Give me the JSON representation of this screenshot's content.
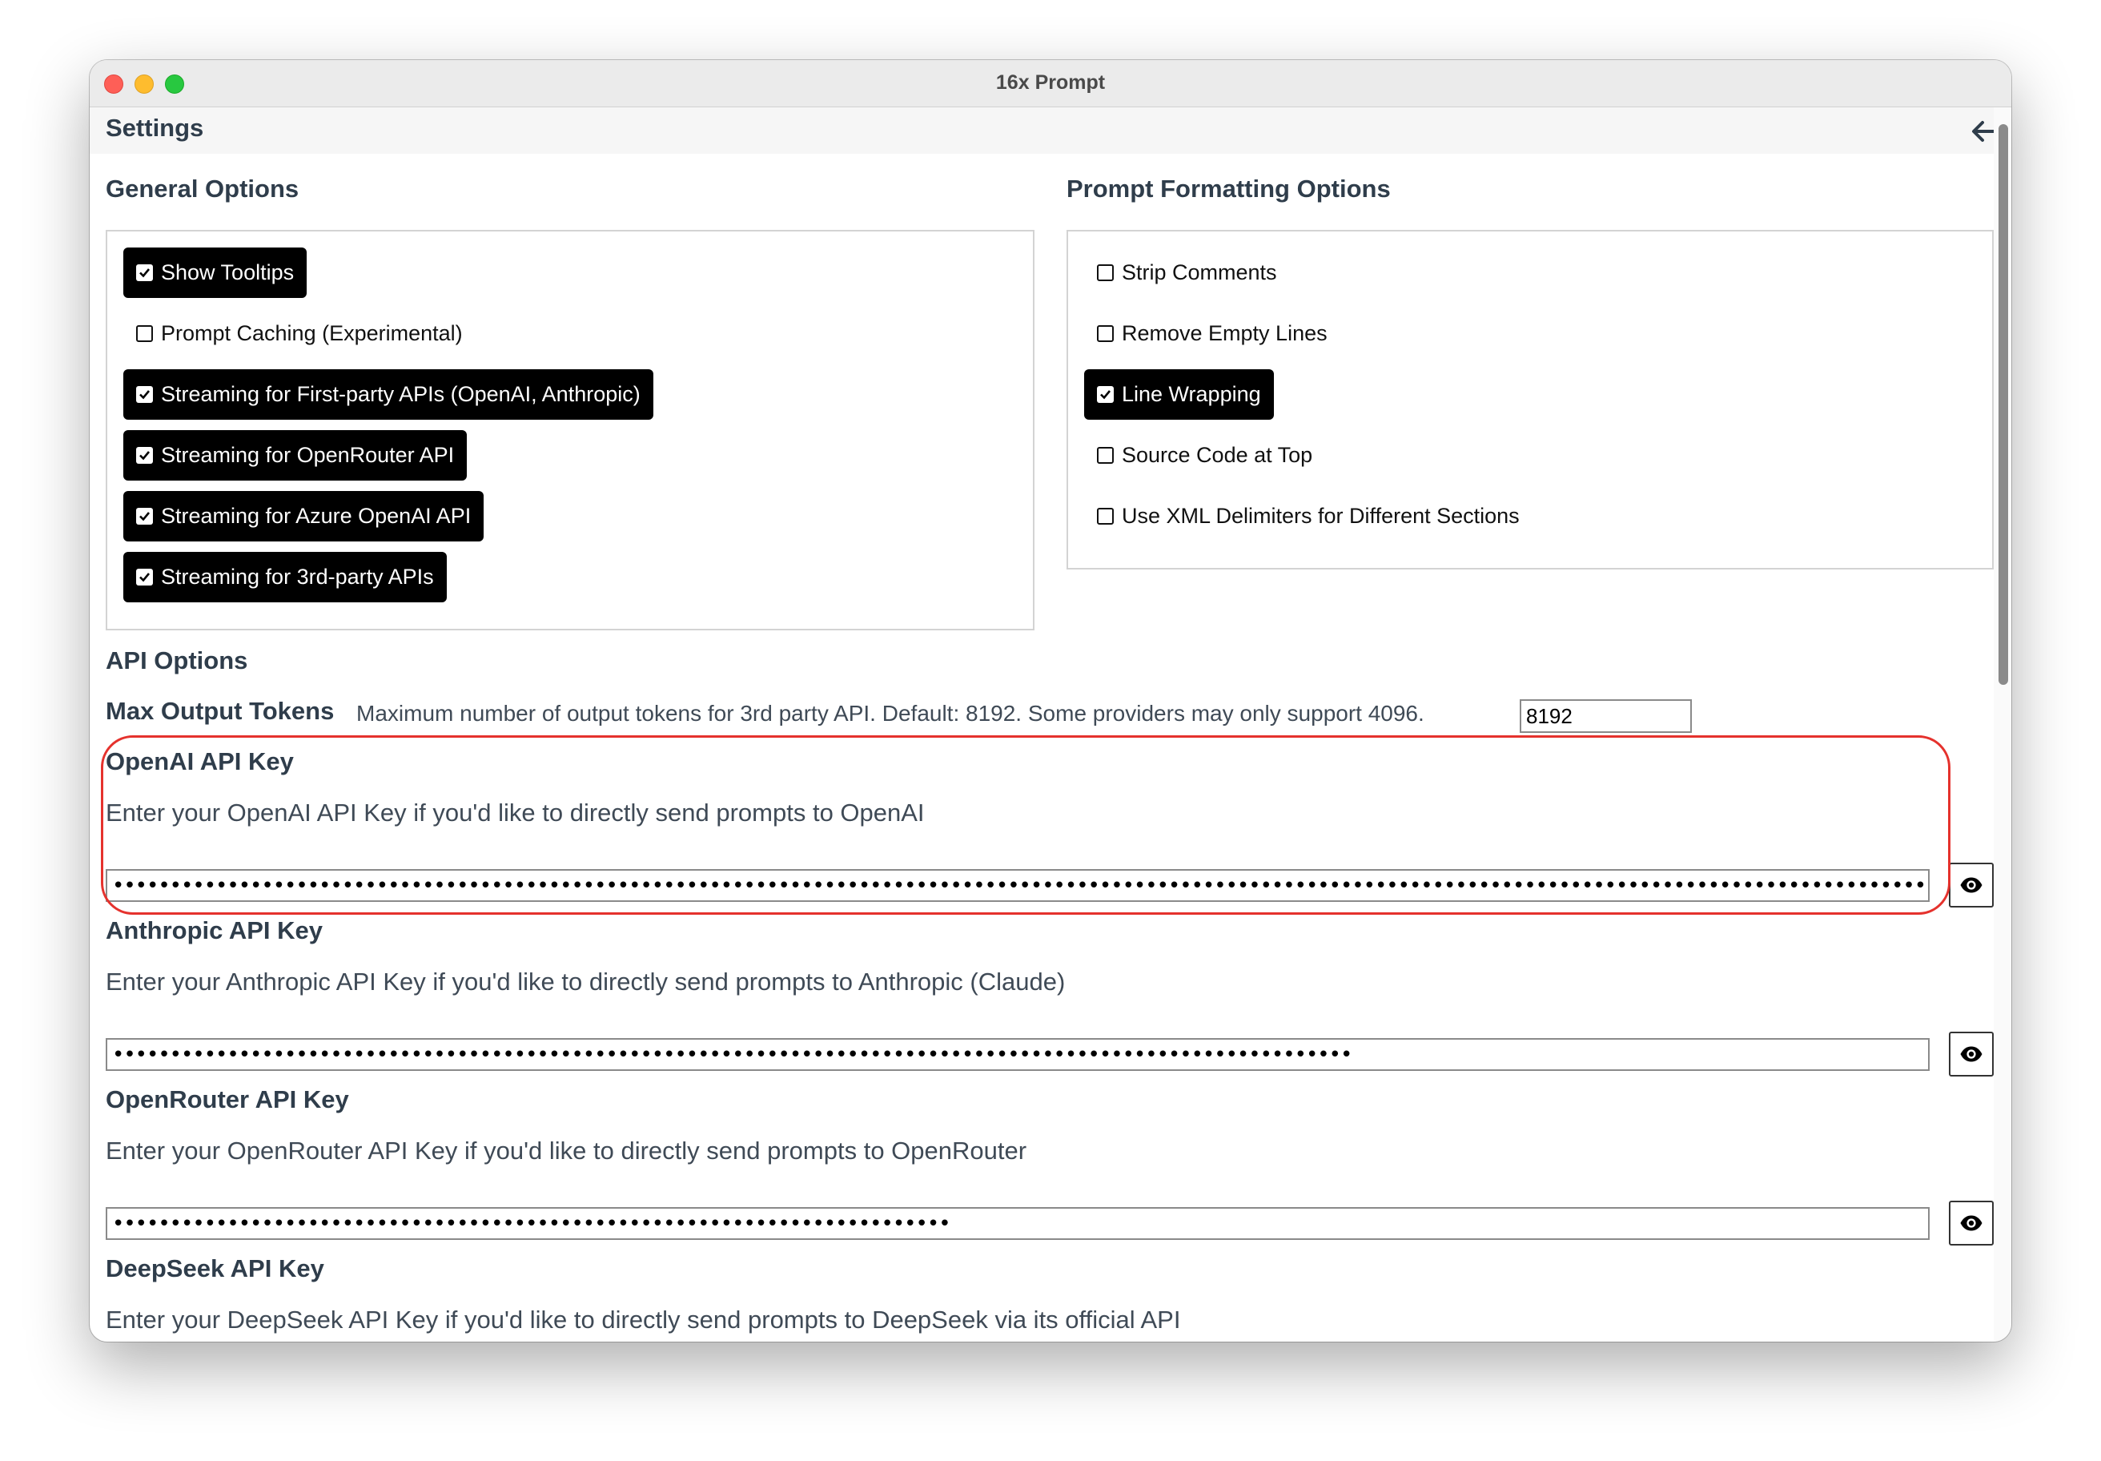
{
  "window": {
    "title": "16x Prompt"
  },
  "header": {
    "title": "Settings",
    "back_icon": "arrow-left-icon"
  },
  "general": {
    "title": "General Options",
    "options": [
      {
        "label": "Show Tooltips",
        "checked": true
      },
      {
        "label": "Prompt Caching (Experimental)",
        "checked": false
      },
      {
        "label": "Streaming for First-party APIs (OpenAI, Anthropic)",
        "checked": true
      },
      {
        "label": "Streaming for OpenRouter API",
        "checked": true
      },
      {
        "label": "Streaming for Azure OpenAI API",
        "checked": true
      },
      {
        "label": "Streaming for 3rd-party APIs",
        "checked": true
      }
    ]
  },
  "formatting": {
    "title": "Prompt Formatting Options",
    "options": [
      {
        "label": "Strip Comments",
        "checked": false
      },
      {
        "label": "Remove Empty Lines",
        "checked": false
      },
      {
        "label": "Line Wrapping",
        "checked": true
      },
      {
        "label": "Source Code at Top",
        "checked": false
      },
      {
        "label": "Use XML Delimiters for Different Sections",
        "checked": false
      }
    ]
  },
  "api": {
    "title": "API Options",
    "max_tokens": {
      "label": "Max Output Tokens",
      "description": "Maximum number of output tokens for 3rd party API. Default: 8192. Some providers may only support 4096.",
      "value": "8192"
    },
    "keys": [
      {
        "label": "OpenAI API Key",
        "description": "Enter your OpenAI API Key if you'd like to directly send prompts to OpenAI",
        "masked_length": 164
      },
      {
        "label": "Anthropic API Key",
        "description": "Enter your Anthropic API Key if you'd like to directly send prompts to Anthropic (Claude)",
        "masked_length": 108
      },
      {
        "label": "OpenRouter API Key",
        "description": "Enter your OpenRouter API Key if you'd like to directly send prompts to OpenRouter",
        "masked_length": 73
      },
      {
        "label": "DeepSeek API Key",
        "description": "Enter your DeepSeek API Key if you'd like to directly send prompts to DeepSeek via its official API"
      }
    ],
    "toggle_icon": "eye-icon"
  },
  "colors": {
    "accent_highlight": "#e5322d",
    "checked_bg": "#000000",
    "heading": "#2f3d4b"
  }
}
